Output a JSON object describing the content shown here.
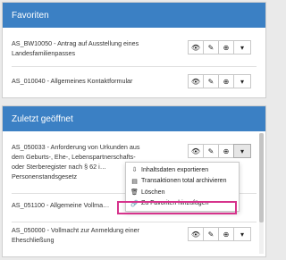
{
  "favorites": {
    "title": "Favoriten",
    "items": [
      {
        "label": "AS_BW10050 - Antrag auf Ausstellung eines Landesfamilienpasses"
      },
      {
        "label": "AS_010040 - Allgemeines Kontaktformular"
      }
    ]
  },
  "recent": {
    "title": "Zuletzt geöffnet",
    "items": [
      {
        "label": "AS_050033 - Anforderung von Urkunden aus dem Geburts-, Ehe-, Lebenspartnerschafts- oder Sterberegister nach § 62 i… Personenstandsgesetz"
      },
      {
        "label": "AS_051100 - Allgemeine Vollma…"
      },
      {
        "label": "AS_050000 - Vollmacht zur Anmeldung einer Eheschließung"
      }
    ]
  },
  "row_buttons": {
    "view_icon": "👁",
    "edit_icon": "✎",
    "globe_icon": "⊕",
    "dropdown_icon": "▾"
  },
  "context_menu": {
    "items": [
      {
        "icon": "⇩",
        "label": "Inhaltsdaten exportieren"
      },
      {
        "icon": "▤",
        "label": "Transaktionen total archivieren"
      },
      {
        "icon": "🗑",
        "label": "Löschen"
      },
      {
        "icon": "🔗",
        "label": "Zu Favoriten hinzufügen"
      }
    ]
  },
  "colors": {
    "header_blue": "#3b80c4",
    "highlight_magenta": "#d6338c"
  }
}
